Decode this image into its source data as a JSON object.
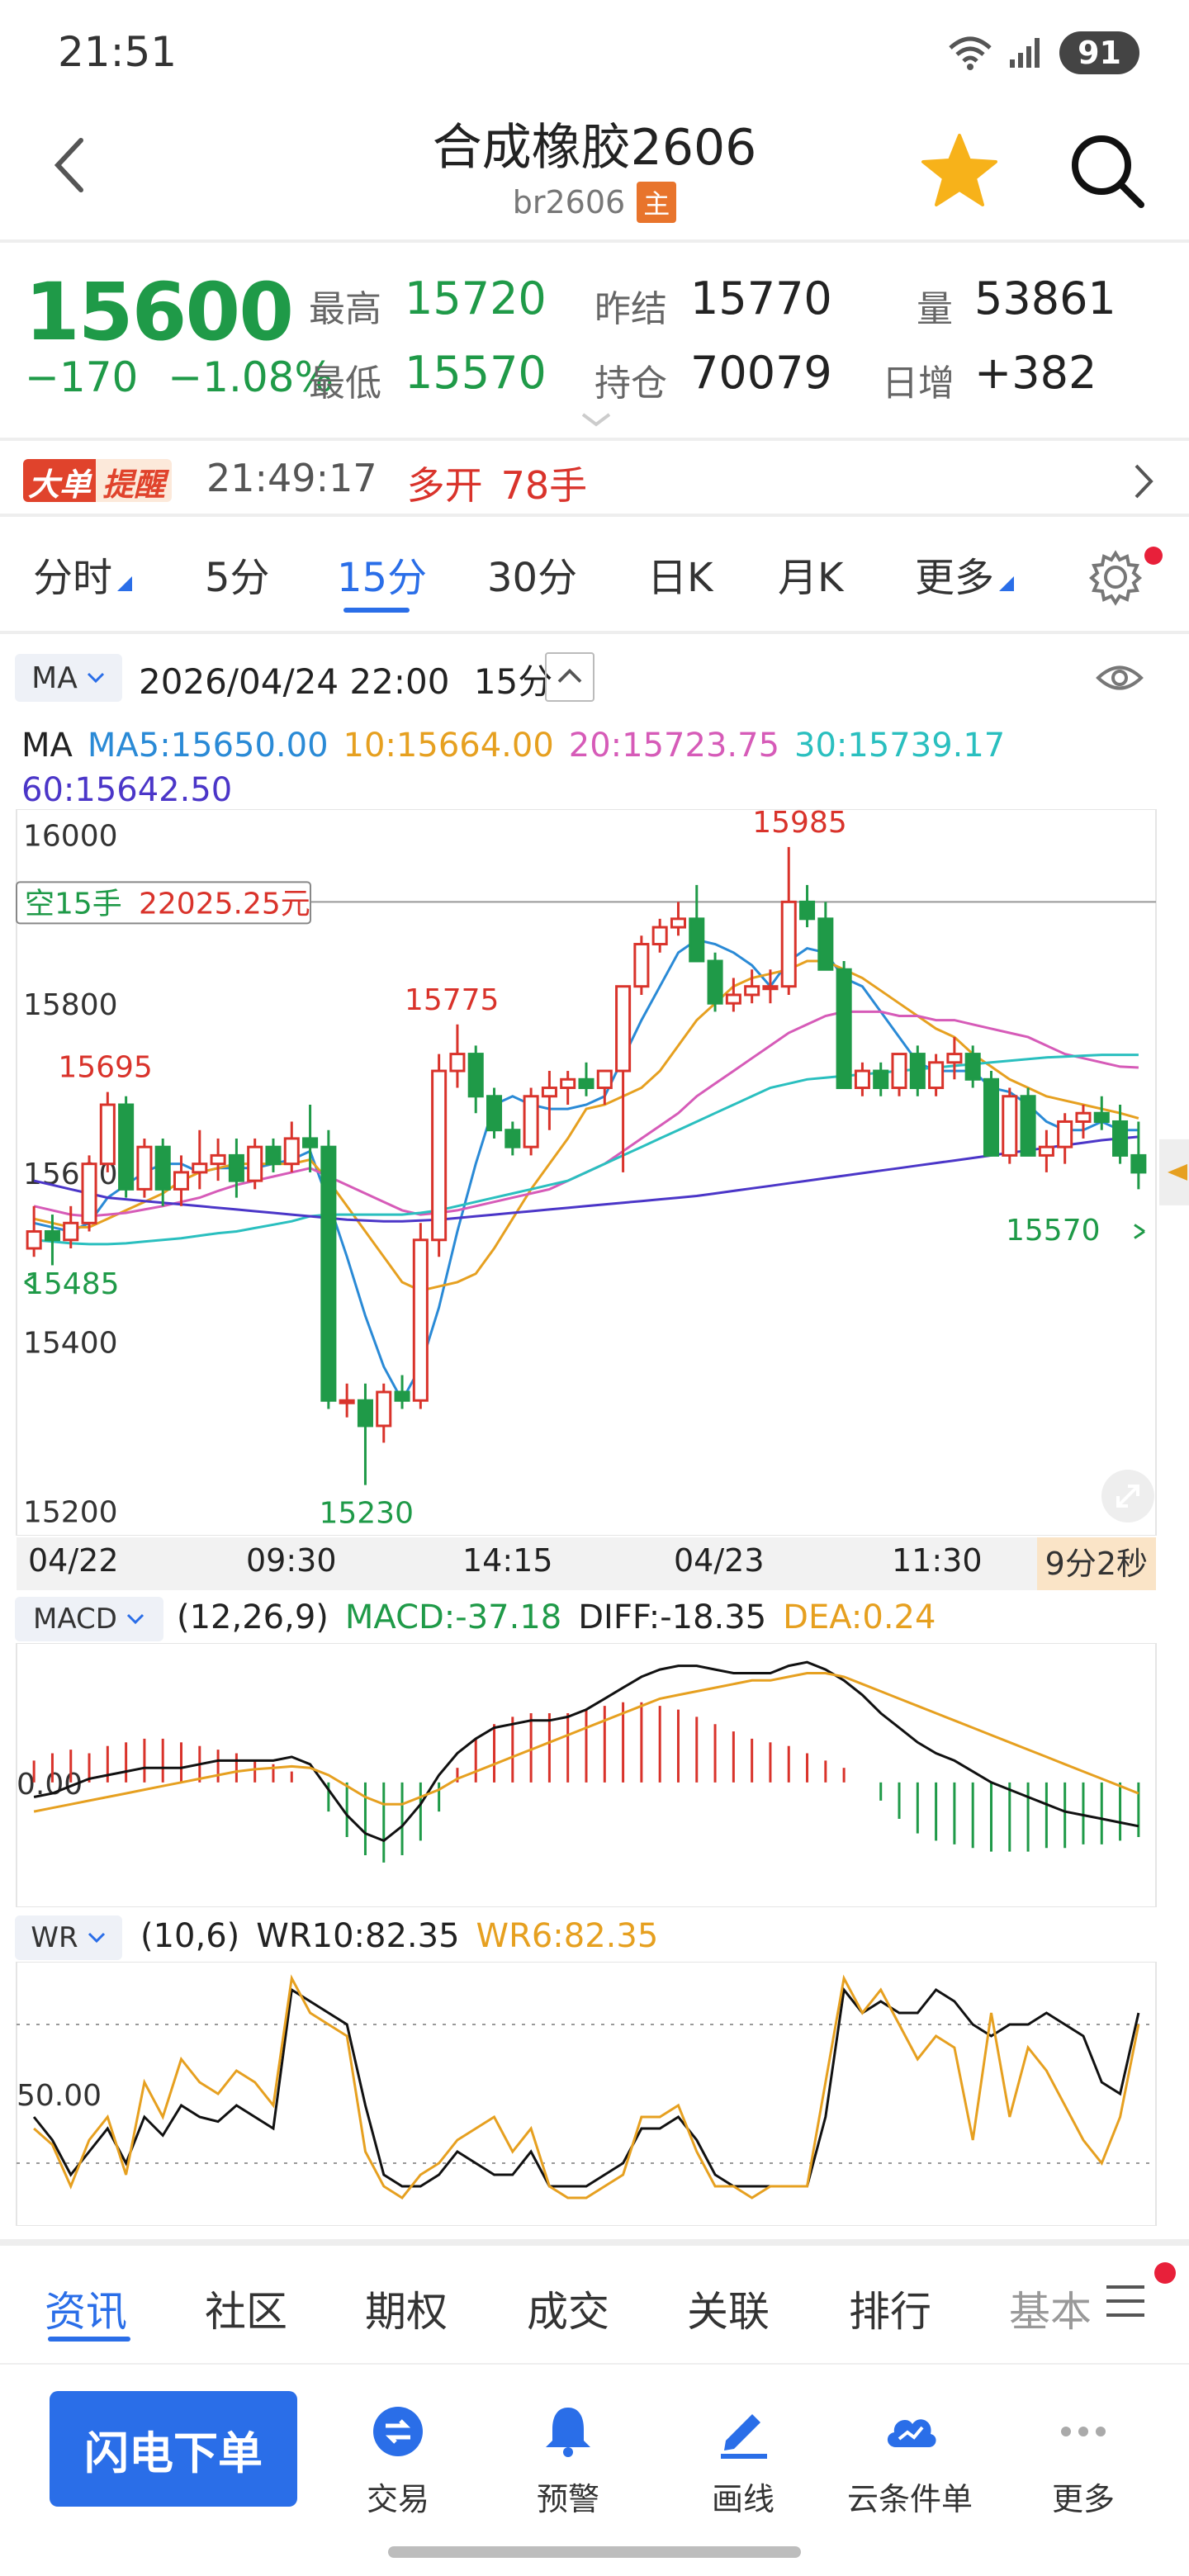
{
  "status": {
    "time": "21:51",
    "battery": "91"
  },
  "header": {
    "title": "合成橡胶2606",
    "code": "br2606",
    "main_badge": "主"
  },
  "quote": {
    "price": "15600",
    "change": "−170",
    "change_pct": "−1.08%",
    "high_label": "最高",
    "high": "15720",
    "low_label": "最低",
    "low": "15570",
    "prev_settle_label": "昨结",
    "prev_settle": "15770",
    "open_interest_label": "持仓",
    "open_interest": "70079",
    "volume_label": "量",
    "volume": "53861",
    "daily_inc_label": "日增",
    "daily_inc": "+382"
  },
  "alert": {
    "logo_a": "大单",
    "logo_b": "提醒",
    "time": "21:49:17",
    "side": "多开",
    "qty": "78手"
  },
  "tabs": [
    {
      "label": "分时",
      "dropdown": true
    },
    {
      "label": "5分"
    },
    {
      "label": "15分",
      "active": true
    },
    {
      "label": "30分"
    },
    {
      "label": "日K"
    },
    {
      "label": "月K"
    },
    {
      "label": "更多",
      "dropdown": true
    }
  ],
  "chart_head": {
    "indicator": "MA",
    "datetime": "2026/04/24 22:00",
    "period": "15分"
  },
  "ma_values": {
    "prefix": "MA",
    "ma5": "MA5:15650.00",
    "ma10": "10:15664.00",
    "ma20": "20:15723.75",
    "ma30": "30:15739.17",
    "ma60": "60:15642.50"
  },
  "colors": {
    "up": "#d9332b",
    "down": "#1f9a48",
    "accent": "#2a6ee8",
    "ma5": "#2a8ad6",
    "ma10": "#e6a020",
    "ma20": "#d65bb8",
    "ma30": "#2abfbf",
    "ma60": "#4b36c8"
  },
  "kline": {
    "y_ticks": [
      "16000",
      "15800",
      "15600",
      "15400",
      "15200"
    ],
    "y_tick_values": [
      16000,
      15800,
      15600,
      15400,
      15200
    ],
    "ylim": [
      15170,
      16020
    ],
    "pending_order": {
      "label": "空15手",
      "price": "22025.25元"
    },
    "annotations": {
      "high_max": "15985",
      "local_high_1": "15695",
      "local_high_2": "15775",
      "low_min": "15230",
      "left_low": "15485",
      "last_low": "15570"
    },
    "x_labels": [
      "04/22",
      "09:30",
      "14:15",
      "04/23",
      "11:30"
    ],
    "countdown": "9分2秒"
  },
  "chart_data": [
    {
      "type": "candlestick",
      "title": "",
      "ylim": [
        15170,
        16020
      ],
      "candles": [
        [
          15510,
          15560,
          15500,
          15530
        ],
        [
          15530,
          15550,
          15490,
          15520
        ],
        [
          15520,
          15560,
          15510,
          15540
        ],
        [
          15540,
          15620,
          15530,
          15610
        ],
        [
          15610,
          15695,
          15600,
          15680
        ],
        [
          15680,
          15690,
          15570,
          15580
        ],
        [
          15580,
          15640,
          15570,
          15630
        ],
        [
          15630,
          15640,
          15560,
          15580
        ],
        [
          15580,
          15620,
          15560,
          15600
        ],
        [
          15600,
          15650,
          15580,
          15610
        ],
        [
          15610,
          15640,
          15590,
          15620
        ],
        [
          15620,
          15640,
          15570,
          15590
        ],
        [
          15590,
          15640,
          15580,
          15630
        ],
        [
          15630,
          15640,
          15600,
          15610
        ],
        [
          15610,
          15660,
          15600,
          15640
        ],
        [
          15640,
          15680,
          15600,
          15630
        ],
        [
          15630,
          15650,
          15320,
          15330
        ],
        [
          15330,
          15350,
          15310,
          15330
        ],
        [
          15330,
          15350,
          15230,
          15300
        ],
        [
          15300,
          15350,
          15280,
          15340
        ],
        [
          15340,
          15360,
          15320,
          15330
        ],
        [
          15330,
          15540,
          15320,
          15520
        ],
        [
          15520,
          15740,
          15500,
          15720
        ],
        [
          15720,
          15775,
          15700,
          15740
        ],
        [
          15740,
          15750,
          15670,
          15690
        ],
        [
          15690,
          15700,
          15640,
          15650
        ],
        [
          15650,
          15660,
          15620,
          15630
        ],
        [
          15630,
          15700,
          15620,
          15690
        ],
        [
          15690,
          15720,
          15650,
          15700
        ],
        [
          15700,
          15720,
          15680,
          15710
        ],
        [
          15710,
          15730,
          15690,
          15700
        ],
        [
          15700,
          15720,
          15680,
          15720
        ],
        [
          15720,
          15820,
          15600,
          15820
        ],
        [
          15820,
          15880,
          15810,
          15870
        ],
        [
          15870,
          15900,
          15860,
          15890
        ],
        [
          15890,
          15920,
          15880,
          15900
        ],
        [
          15900,
          15940,
          15860,
          15850
        ],
        [
          15850,
          15860,
          15790,
          15800
        ],
        [
          15800,
          15830,
          15790,
          15810
        ],
        [
          15810,
          15840,
          15800,
          15820
        ],
        [
          15820,
          15840,
          15800,
          15820
        ],
        [
          15820,
          15985,
          15810,
          15920
        ],
        [
          15920,
          15940,
          15890,
          15900
        ],
        [
          15900,
          15920,
          15840,
          15840
        ],
        [
          15840,
          15850,
          15700,
          15700
        ],
        [
          15700,
          15730,
          15690,
          15720
        ],
        [
          15720,
          15730,
          15690,
          15700
        ],
        [
          15700,
          15740,
          15690,
          15740
        ],
        [
          15740,
          15750,
          15690,
          15700
        ],
        [
          15700,
          15740,
          15690,
          15730
        ],
        [
          15730,
          15760,
          15710,
          15740
        ],
        [
          15740,
          15750,
          15700,
          15710
        ],
        [
          15710,
          15720,
          15620,
          15620
        ],
        [
          15620,
          15700,
          15610,
          15690
        ],
        [
          15690,
          15700,
          15620,
          15620
        ],
        [
          15620,
          15650,
          15600,
          15630
        ],
        [
          15630,
          15670,
          15610,
          15660
        ],
        [
          15660,
          15680,
          15640,
          15670
        ],
        [
          15670,
          15690,
          15650,
          15660
        ],
        [
          15660,
          15680,
          15610,
          15620
        ],
        [
          15620,
          15660,
          15580,
          15600
        ]
      ],
      "series": [
        {
          "name": "MA5",
          "values": [
            15540,
            15535,
            15530,
            15540,
            15570,
            15585,
            15600,
            15610,
            15610,
            15600,
            15605,
            15605,
            15605,
            15610,
            15615,
            15625,
            15565,
            15500,
            15430,
            15370,
            15330,
            15370,
            15440,
            15530,
            15610,
            15680,
            15690,
            15680,
            15675,
            15675,
            15680,
            15690,
            15735,
            15780,
            15820,
            15860,
            15875,
            15870,
            15860,
            15845,
            15820,
            15850,
            15865,
            15860,
            15830,
            15820,
            15790,
            15760,
            15730,
            15720,
            15720,
            15720,
            15700,
            15695,
            15680,
            15660,
            15650,
            15650,
            15660,
            15650,
            15650
          ]
        },
        {
          "name": "10",
          "values": [
            15545,
            15540,
            15535,
            15535,
            15545,
            15555,
            15565,
            15575,
            15590,
            15600,
            15605,
            15610,
            15610,
            15610,
            15610,
            15615,
            15590,
            15560,
            15530,
            15500,
            15470,
            15460,
            15465,
            15470,
            15480,
            15510,
            15545,
            15580,
            15610,
            15640,
            15675,
            15680,
            15690,
            15700,
            15720,
            15750,
            15780,
            15800,
            15820,
            15830,
            15835,
            15840,
            15850,
            15850,
            15840,
            15830,
            15815,
            15800,
            15785,
            15770,
            15760,
            15740,
            15725,
            15710,
            15700,
            15690,
            15685,
            15680,
            15675,
            15670,
            15664
          ]
        },
        {
          "name": "20",
          "values": [
            15560,
            15555,
            15550,
            15548,
            15550,
            15552,
            15556,
            15560,
            15565,
            15570,
            15578,
            15585,
            15590,
            15595,
            15600,
            15605,
            15595,
            15585,
            15575,
            15565,
            15555,
            15550,
            15552,
            15555,
            15560,
            15565,
            15570,
            15575,
            15580,
            15590,
            15600,
            15610,
            15625,
            15640,
            15655,
            15670,
            15690,
            15705,
            15720,
            15735,
            15750,
            15765,
            15775,
            15785,
            15790,
            15790,
            15790,
            15785,
            15785,
            15780,
            15780,
            15775,
            15770,
            15765,
            15760,
            15750,
            15740,
            15735,
            15730,
            15725,
            15724
          ]
        },
        {
          "name": "30",
          "values": [
            15520,
            15518,
            15516,
            15515,
            15515,
            15516,
            15518,
            15520,
            15522,
            15525,
            15528,
            15530,
            15534,
            15538,
            15542,
            15548,
            15550,
            15550,
            15550,
            15550,
            15550,
            15552,
            15555,
            15560,
            15565,
            15570,
            15575,
            15580,
            15585,
            15590,
            15600,
            15610,
            15620,
            15630,
            15640,
            15650,
            15660,
            15670,
            15680,
            15690,
            15700,
            15705,
            15710,
            15712,
            15714,
            15716,
            15718,
            15720,
            15722,
            15724,
            15726,
            15728,
            15730,
            15732,
            15734,
            15736,
            15737,
            15738,
            15739,
            15739,
            15739
          ]
        },
        {
          "name": "60",
          "values": [
            15590,
            15585,
            15580,
            15575,
            15570,
            15568,
            15566,
            15564,
            15562,
            15560,
            15558,
            15556,
            15554,
            15552,
            15550,
            15548,
            15546,
            15544,
            15543,
            15542,
            15542,
            15543,
            15544,
            15546,
            15548,
            15550,
            15552,
            15554,
            15556,
            15558,
            15560,
            15562,
            15564,
            15566,
            15568,
            15570,
            15572,
            15575,
            15578,
            15581,
            15584,
            15587,
            15590,
            15593,
            15596,
            15599,
            15602,
            15605,
            15608,
            15611,
            15614,
            15617,
            15620,
            15623,
            15626,
            15629,
            15632,
            15635,
            15638,
            15640,
            15642
          ]
        }
      ]
    },
    {
      "type": "bar",
      "title": "",
      "params": "(12,26,9)",
      "macd_label": "MACD:-37.18",
      "diff_label": "DIFF:-18.35",
      "dea_label": "DEA:0.24",
      "zero_label": "0.00",
      "ylim": [
        -160,
        180
      ],
      "macd": [
        30,
        40,
        45,
        40,
        50,
        55,
        60,
        60,
        55,
        50,
        45,
        40,
        30,
        25,
        15,
        0,
        -40,
        -75,
        -100,
        -110,
        -100,
        -80,
        -40,
        20,
        60,
        80,
        90,
        95,
        95,
        95,
        100,
        105,
        110,
        110,
        105,
        100,
        90,
        80,
        70,
        60,
        55,
        50,
        40,
        30,
        20,
        0,
        -25,
        -50,
        -70,
        -80,
        -85,
        -90,
        -95,
        -95,
        -95,
        -90,
        -90,
        -85,
        -85,
        -80,
        -75
      ],
      "diff": [
        -20,
        -15,
        -5,
        5,
        10,
        15,
        20,
        20,
        20,
        25,
        30,
        30,
        30,
        30,
        35,
        25,
        -10,
        -45,
        -70,
        -80,
        -60,
        -30,
        10,
        40,
        60,
        75,
        80,
        85,
        85,
        90,
        100,
        115,
        130,
        145,
        155,
        160,
        160,
        155,
        150,
        150,
        150,
        160,
        165,
        155,
        140,
        120,
        95,
        75,
        55,
        40,
        30,
        15,
        0,
        -10,
        -20,
        -30,
        -40,
        -45,
        -50,
        -55,
        -60
      ],
      "dea": [
        -40,
        -35,
        -30,
        -25,
        -20,
        -15,
        -10,
        -5,
        0,
        5,
        10,
        15,
        18,
        20,
        22,
        20,
        10,
        -5,
        -20,
        -30,
        -30,
        -20,
        -10,
        5,
        15,
        25,
        35,
        45,
        55,
        65,
        75,
        85,
        95,
        105,
        115,
        120,
        125,
        130,
        135,
        140,
        140,
        145,
        150,
        150,
        145,
        135,
        125,
        115,
        105,
        95,
        85,
        75,
        65,
        55,
        45,
        35,
        25,
        15,
        5,
        -5,
        -15
      ]
    },
    {
      "type": "line",
      "title": "",
      "params": "(10,6)",
      "wr10_label": "WR10:82.35",
      "wr6_label": "WR6:82.35",
      "ref_label": "50.00",
      "ylim": [
        0,
        100
      ],
      "series": [
        {
          "name": "WR10",
          "values": [
            40,
            30,
            15,
            25,
            35,
            20,
            40,
            32,
            45,
            40,
            38,
            45,
            40,
            35,
            95,
            90,
            85,
            80,
            45,
            15,
            10,
            10,
            15,
            25,
            20,
            15,
            15,
            25,
            10,
            10,
            10,
            15,
            20,
            35,
            35,
            40,
            30,
            15,
            10,
            10,
            10,
            10,
            10,
            40,
            95,
            85,
            90,
            85,
            85,
            95,
            90,
            80,
            75,
            80,
            80,
            85,
            80,
            75,
            55,
            50,
            85
          ]
        },
        {
          "name": "WR6",
          "values": [
            35,
            28,
            10,
            30,
            40,
            15,
            55,
            40,
            65,
            55,
            50,
            60,
            55,
            45,
            100,
            85,
            80,
            75,
            25,
            10,
            5,
            15,
            20,
            30,
            35,
            40,
            25,
            35,
            10,
            5,
            5,
            10,
            15,
            40,
            40,
            45,
            25,
            10,
            10,
            5,
            10,
            10,
            10,
            55,
            100,
            85,
            95,
            80,
            65,
            75,
            70,
            30,
            85,
            40,
            70,
            60,
            45,
            30,
            20,
            40,
            80
          ]
        }
      ]
    }
  ],
  "macd_head": {
    "indicator": "MACD",
    "params": "(12,26,9)",
    "macd": "MACD:-37.18",
    "diff": "DIFF:-18.35",
    "dea": "DEA:0.24"
  },
  "wr_head": {
    "indicator": "WR",
    "params": "(10,6)",
    "wr10": "WR10:82.35",
    "wr6": "WR6:82.35"
  },
  "news_tabs": [
    {
      "label": "资讯",
      "active": true
    },
    {
      "label": "社区"
    },
    {
      "label": "期权"
    },
    {
      "label": "成交"
    },
    {
      "label": "关联"
    },
    {
      "label": "排行"
    },
    {
      "label": "基本"
    }
  ],
  "toolbar": {
    "flash_order": "闪电下单",
    "items": [
      {
        "label": "交易",
        "icon": "trade-icon"
      },
      {
        "label": "预警",
        "icon": "bell-icon"
      },
      {
        "label": "画线",
        "icon": "draw-line-icon"
      },
      {
        "label": "云条件单",
        "icon": "cloud-order-icon"
      },
      {
        "label": "更多",
        "icon": "more-icon"
      }
    ]
  }
}
